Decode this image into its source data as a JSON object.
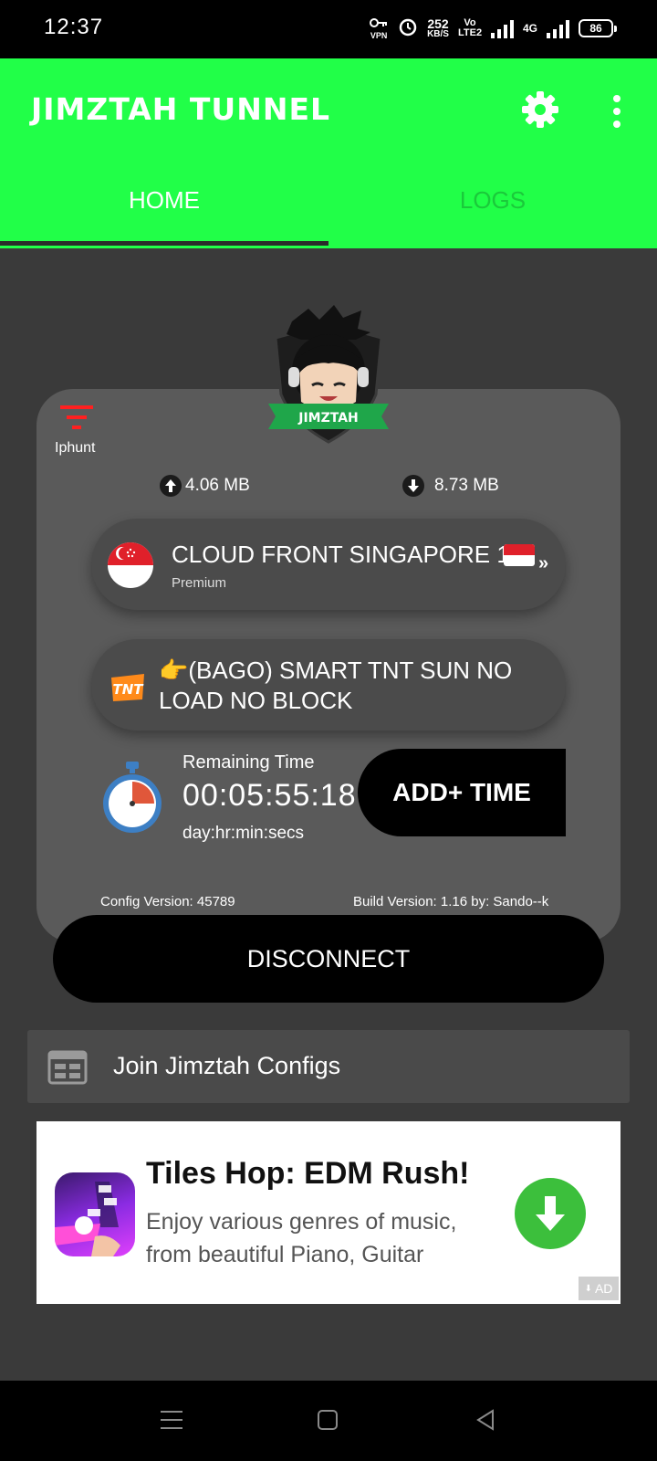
{
  "status_bar": {
    "time": "12:37",
    "vpn": "VPN",
    "speed": "252",
    "speed_unit": "KB/S",
    "volte": "Vo LTE2",
    "network": "4G",
    "battery": "86"
  },
  "app_bar": {
    "title": "JIMZTAH TUNNEL",
    "tabs": [
      {
        "label": "HOME",
        "active": true
      },
      {
        "label": "LOGS",
        "active": false
      }
    ],
    "accent_color": "#21ff48"
  },
  "logo": {
    "text": "JIMZTAH"
  },
  "main": {
    "filter_label": "Iphunt",
    "upload": "4.06 MB",
    "download": "8.73 MB",
    "server": {
      "name": "CLOUD FRONT SINGAPORE 1",
      "tier": "Premium"
    },
    "payload": {
      "name": "👉(BAGO) SMART TNT SUN NO LOAD NO BLOCK"
    },
    "timer": {
      "label": "Remaining Time",
      "value": "00:05:55:18",
      "format": "day:hr:min:secs"
    },
    "add_time_label": "ADD+ TIME",
    "config_version": "Config Version: 45789",
    "build_version": "Build Version: 1.16 by: Sando--k",
    "disconnect_label": "DISCONNECT"
  },
  "join": {
    "label": "Join Jimztah Configs"
  },
  "ad": {
    "title": "Tiles Hop: EDM Rush!",
    "description": "Enjoy various genres of music, from beautiful Piano, Guitar",
    "badge": "AD"
  }
}
